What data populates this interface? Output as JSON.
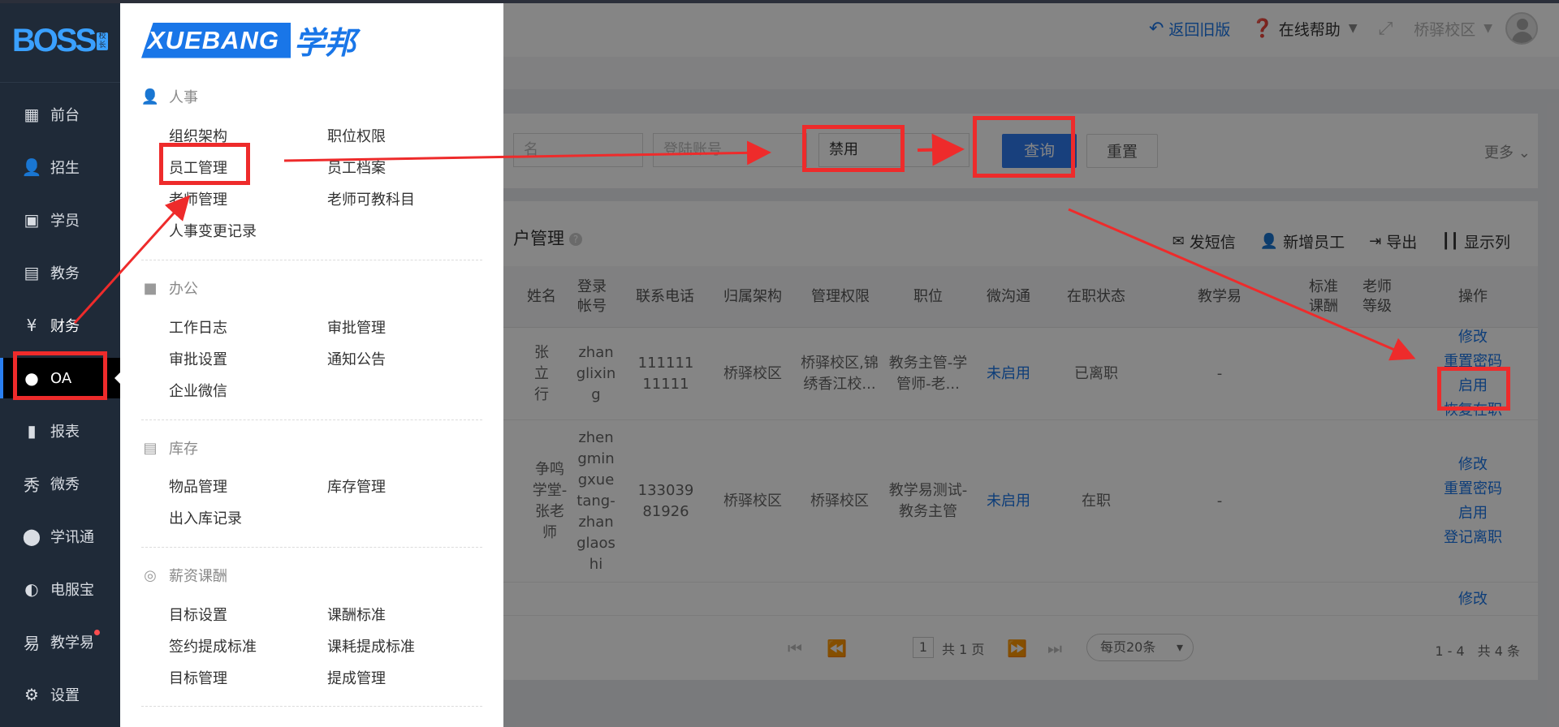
{
  "sidebar": {
    "logo_text": "BOSS",
    "logo_badge": "校长",
    "items": [
      {
        "label": "前台",
        "icon": "calendar-icon"
      },
      {
        "label": "招生",
        "icon": "user-add-icon"
      },
      {
        "label": "学员",
        "icon": "student-card-icon"
      },
      {
        "label": "教务",
        "icon": "book-icon"
      },
      {
        "label": "财务",
        "icon": "yen-icon"
      },
      {
        "label": "OA",
        "icon": "chat-bubbles-icon"
      },
      {
        "label": "报表",
        "icon": "bar-chart-icon"
      },
      {
        "label": "微秀",
        "icon": "weixiu-icon"
      },
      {
        "label": "学讯通",
        "icon": "location-pin-icon"
      },
      {
        "label": "电服宝",
        "icon": "phone-service-icon"
      },
      {
        "label": "教学易",
        "icon": "teach-icon"
      },
      {
        "label": "设置",
        "icon": "gear-icon"
      }
    ],
    "active": "OA"
  },
  "flyout": {
    "logo_en": "XUEBANG",
    "logo_cn": "学邦",
    "sections": [
      {
        "title": "人事",
        "icon": "person-list-icon",
        "links": [
          "组织架构",
          "职位权限",
          "员工管理",
          "员工档案",
          "老师管理",
          "老师可教科目",
          "人事变更记录"
        ]
      },
      {
        "title": "办公",
        "icon": "briefcase-icon",
        "links": [
          "工作日志",
          "审批管理",
          "审批设置",
          "通知公告",
          "企业微信"
        ]
      },
      {
        "title": "库存",
        "icon": "warehouse-icon",
        "links": [
          "物品管理",
          "库存管理",
          "出入库记录"
        ]
      },
      {
        "title": "薪资课酬",
        "icon": "target-icon",
        "links": [
          "目标设置",
          "课酬标准",
          "签约提成标准",
          "课耗提成标准",
          "目标管理",
          "提成管理"
        ]
      }
    ]
  },
  "header": {
    "old_version": "返回旧版",
    "help": "在线帮助",
    "campus": "桥驿校区"
  },
  "filter": {
    "name_placeholder": "名",
    "account_placeholder": "登陆账号",
    "status_value": "禁用",
    "query_label": "查询",
    "reset_label": "重置",
    "more_label": "更多"
  },
  "table": {
    "title": "户管理",
    "actions": [
      "发短信",
      "新增员工",
      "导出",
      "显示列"
    ],
    "columns": [
      "姓名",
      "登录帐号",
      "联系电话",
      "归属架构",
      "管理权限",
      "职位",
      "微沟通",
      "在职状态",
      "教学易",
      "标准课酬",
      "老师等级",
      "操作"
    ],
    "rows": [
      {
        "name": "张立行",
        "account": "zhanglixing",
        "phone": "11111111111",
        "org": "桥驿校区",
        "perm": "桥驿校区,锦绣香江校...",
        "position": "教务主管-学管师-老...",
        "wechat": "未启用",
        "status": "已离职",
        "jxy": "-",
        "ops": [
          "修改",
          "重置密码",
          "启用",
          "恢复在职"
        ]
      },
      {
        "name": "争鸣学堂-张老师",
        "account": "zhengmingxuetang-zhanglaoshi",
        "phone": "13303981926",
        "org": "桥驿校区",
        "perm": "桥驿校区",
        "position": "教学易测试-教务主管",
        "wechat": "未启用",
        "status": "在职",
        "jxy": "-",
        "ops": [
          "修改",
          "重置密码",
          "启用",
          "登记离职"
        ]
      },
      {
        "ops": [
          "修改"
        ]
      }
    ],
    "pager": {
      "page": "1",
      "total_pages": "共 1 页",
      "page_size": "每页20条",
      "count": "1 - 4　共 4 条"
    }
  }
}
